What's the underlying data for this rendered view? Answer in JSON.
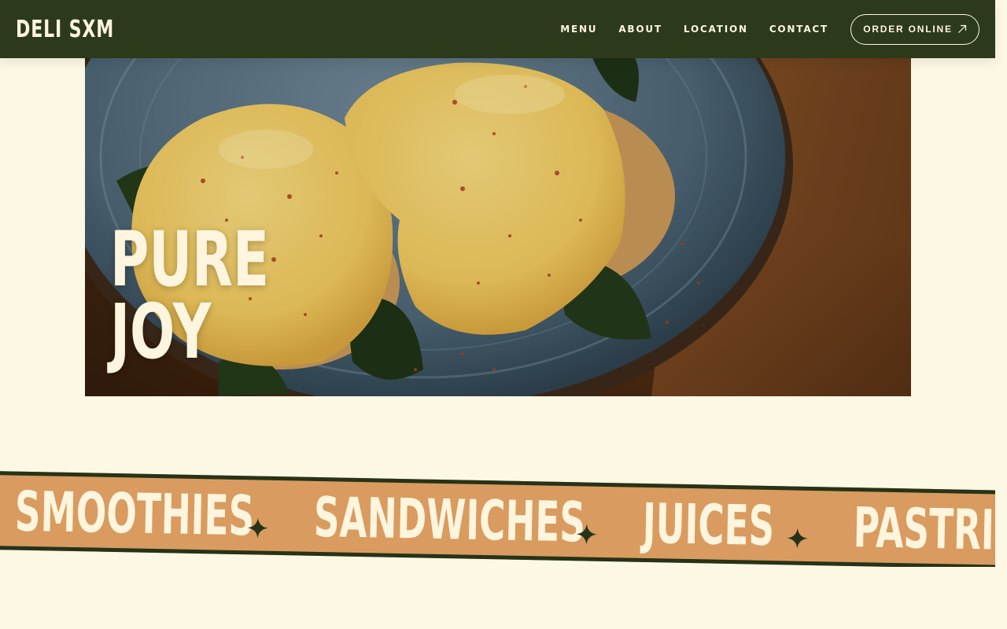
{
  "brand": {
    "name": "DELI SXM"
  },
  "nav": {
    "links": [
      "MENU",
      "ABOUT",
      "LOCATION",
      "CONTACT"
    ],
    "order_label": "ORDER ONLINE"
  },
  "hero": {
    "title_line1": "PURE",
    "title_line2": "JOY"
  },
  "marquee": {
    "items": [
      "SMOOTHIES",
      "SANDWICHES",
      "JUICES",
      "PASTRIES"
    ]
  },
  "colors": {
    "header_bg": "#2c3a1b",
    "page_bg": "#fdf8e4",
    "band_bg": "#d99b5f",
    "accent_dark": "#263318",
    "text_light": "#fdf5dd"
  },
  "icons": {
    "order": "arrow-up-right-icon",
    "separator": "four-point-star-icon"
  }
}
